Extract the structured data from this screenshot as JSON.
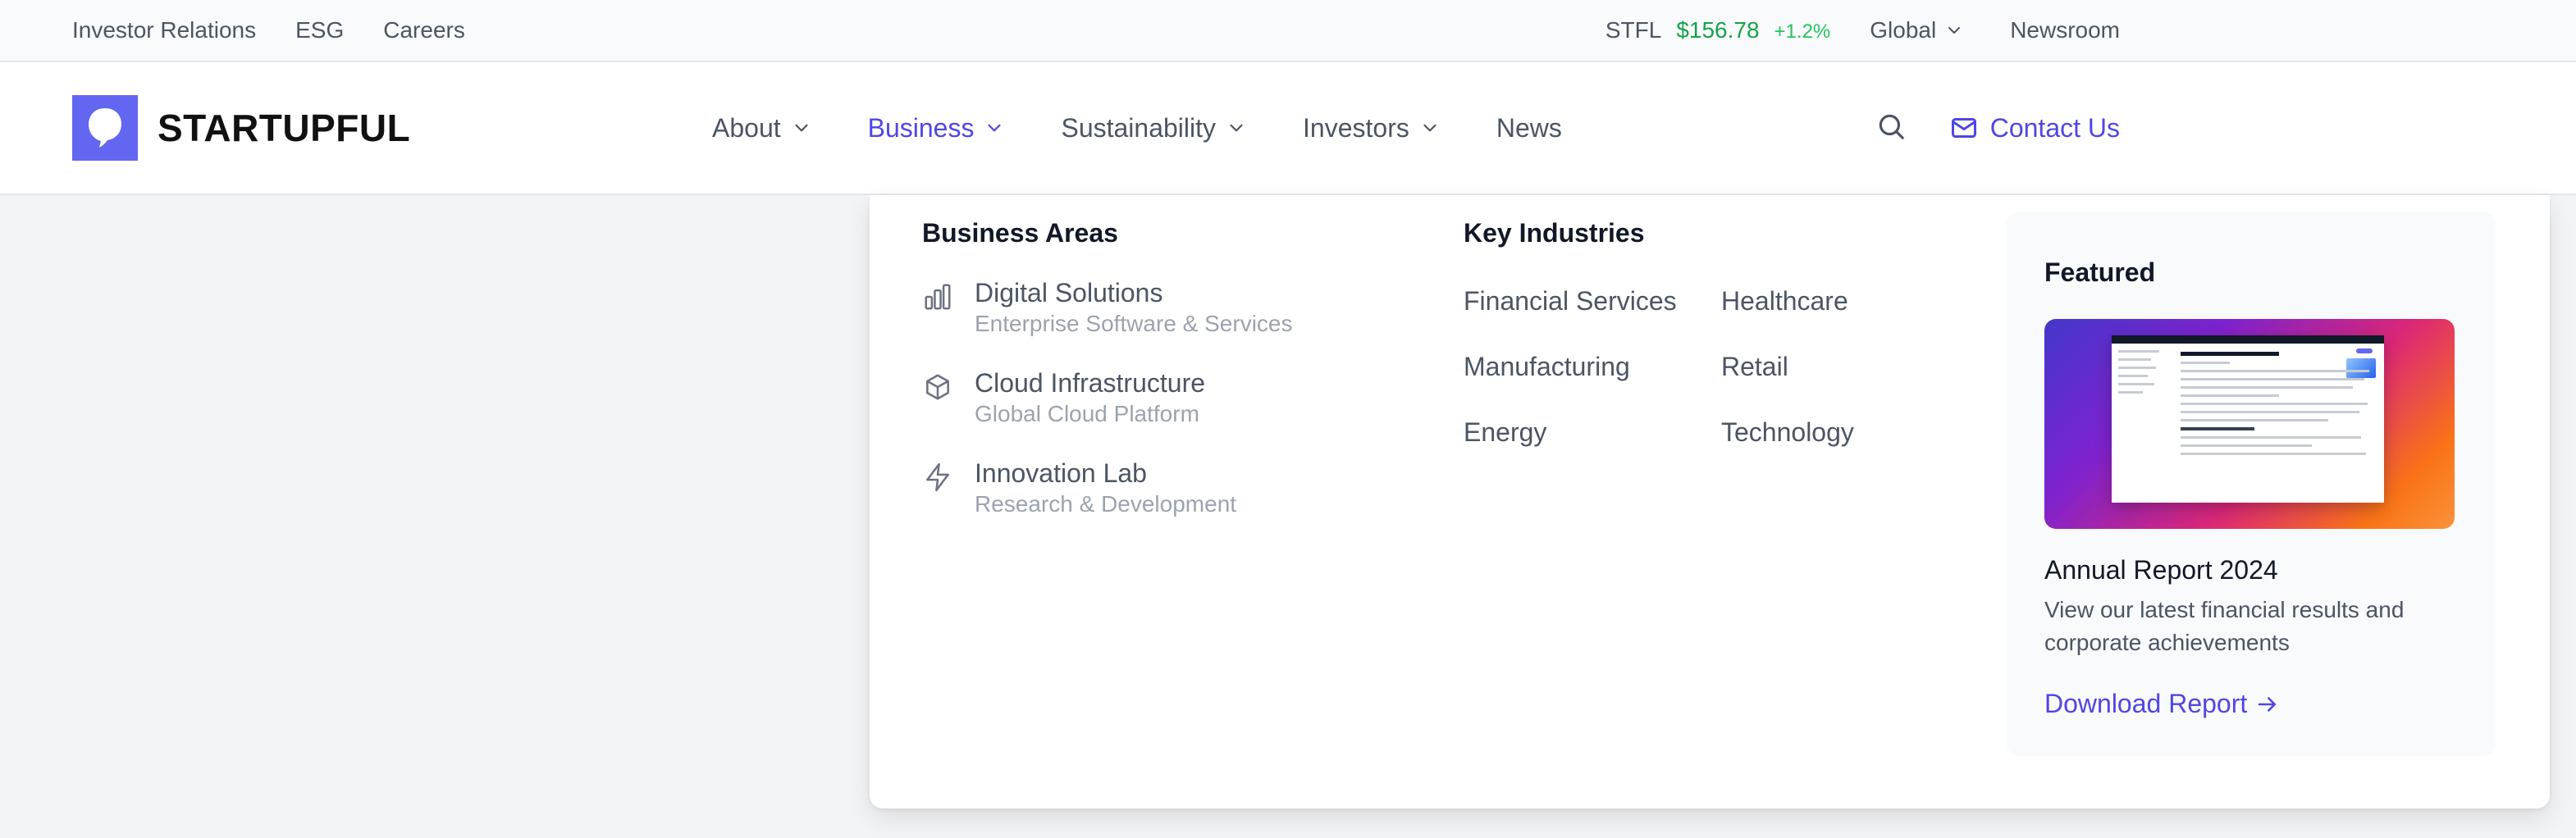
{
  "topbar": {
    "links": [
      "Investor Relations",
      "ESG",
      "Careers"
    ],
    "ticker": {
      "symbol": "STFL",
      "price": "$156.78",
      "change": "+1.2%"
    },
    "region": "Global",
    "newsroom": "Newsroom"
  },
  "brand": {
    "name": "STARTUPFUL",
    "accent": "#6366f1"
  },
  "nav": {
    "items": [
      {
        "label": "About",
        "dropdown": true
      },
      {
        "label": "Business",
        "dropdown": true,
        "active": true
      },
      {
        "label": "Sustainability",
        "dropdown": true
      },
      {
        "label": "Investors",
        "dropdown": true
      },
      {
        "label": "News",
        "dropdown": false
      }
    ],
    "contact": "Contact Us"
  },
  "mega": {
    "areas_title": "Business Areas",
    "areas": [
      {
        "name": "Digital Solutions",
        "sub": "Enterprise Software & Services",
        "icon": "bar-chart-icon"
      },
      {
        "name": "Cloud Infrastructure",
        "sub": "Global Cloud Platform",
        "icon": "cube-icon"
      },
      {
        "name": "Innovation Lab",
        "sub": "Research & Development",
        "icon": "lightning-icon"
      }
    ],
    "industries_title": "Key Industries",
    "industries": [
      "Financial Services",
      "Healthcare",
      "Manufacturing",
      "Retail",
      "Energy",
      "Technology"
    ],
    "featured": {
      "heading": "Featured",
      "title": "Annual Report 2024",
      "description": "View our latest financial results and corporate achievements",
      "cta": "Download Report"
    }
  },
  "colors": {
    "link": "#4f46e5",
    "positive": "#16a34a",
    "text": "#4b5563",
    "muted": "#9ca3af"
  }
}
